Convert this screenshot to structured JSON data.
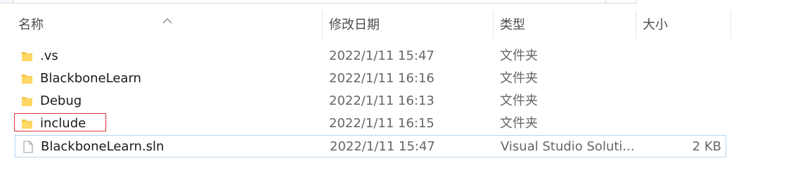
{
  "columns": {
    "name": "名称",
    "date_modified": "修改日期",
    "type": "类型",
    "size": "大小"
  },
  "sort": {
    "column": "name",
    "direction": "ascending",
    "icon": "chevron-up-icon"
  },
  "files": [
    {
      "name": ".vs",
      "date": "2022/1/11 15:47",
      "type": "文件夹",
      "size": "",
      "icon": "folder-icon"
    },
    {
      "name": "BlackboneLearn",
      "date": "2022/1/11 16:16",
      "type": "文件夹",
      "size": "",
      "icon": "folder-icon"
    },
    {
      "name": "Debug",
      "date": "2022/1/11 16:13",
      "type": "文件夹",
      "size": "",
      "icon": "folder-icon"
    },
    {
      "name": "include",
      "date": "2022/1/11 16:15",
      "type": "文件夹",
      "size": "",
      "icon": "folder-icon"
    },
    {
      "name": "BlackboneLearn.sln",
      "date": "2022/1/11 15:47",
      "type": "Visual Studio Soluti...",
      "size": "2 KB",
      "icon": "file-icon"
    }
  ],
  "selected_index": 4,
  "annotation": {
    "target": "include",
    "color": "#e0343a"
  },
  "colors": {
    "folder": "#f4c542",
    "selection_border": "#b5d6f2",
    "header_text": "#4d4d4d",
    "secondary_text": "#666666"
  }
}
